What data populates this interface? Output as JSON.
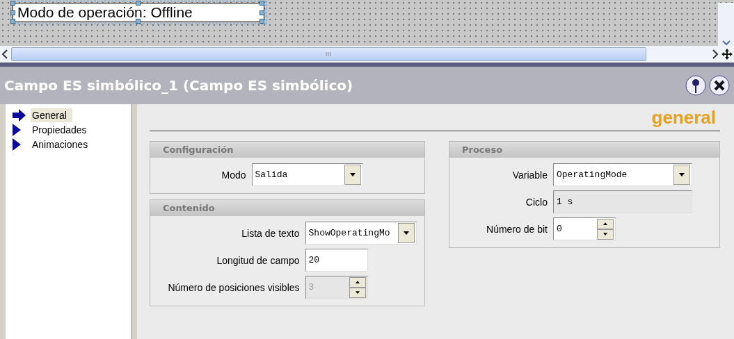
{
  "canvas": {
    "text_box": "Modo de operación: Offline",
    "selected": true
  },
  "panel": {
    "title": "Campo ES simbólico_1 (Campo ES simbólico)"
  },
  "nav": [
    {
      "label": "General",
      "selected": true
    },
    {
      "label": "Propiedades",
      "selected": false
    },
    {
      "label": "Animaciones",
      "selected": false
    }
  ],
  "heading": "general",
  "groups": [
    {
      "title": "Configuración",
      "fields": [
        {
          "label": "Modo",
          "kind": "dropdown",
          "value": "Salida",
          "disabled": false
        }
      ]
    },
    {
      "title": "Contenido",
      "fields": [
        {
          "label": "Lista de texto",
          "kind": "dropdown",
          "value": "ShowOperatingMo",
          "disabled": false
        },
        {
          "label": "Longitud de campo",
          "kind": "text",
          "value": "20",
          "disabled": false
        },
        {
          "label": "Número de posiciones visibles",
          "kind": "spinner",
          "value": "3",
          "disabled": true
        }
      ]
    },
    {
      "title": "Proceso",
      "fields": [
        {
          "label": "Variable",
          "kind": "dropdown",
          "value": "OperatingMode",
          "disabled": false
        },
        {
          "label": "Ciclo",
          "kind": "readonly",
          "value": "1 s",
          "disabled": false
        },
        {
          "label": "Número de bit",
          "kind": "spinner",
          "value": "0",
          "disabled": false
        }
      ]
    }
  ]
}
